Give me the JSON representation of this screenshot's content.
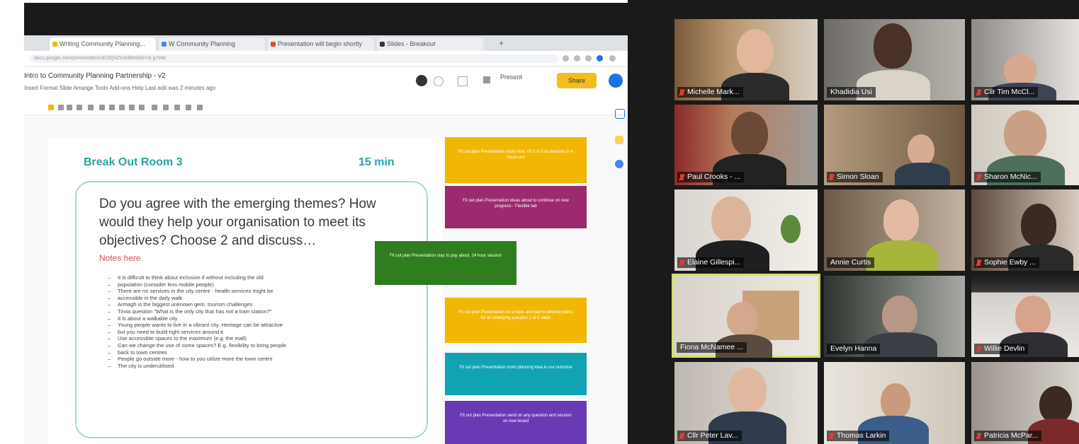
{
  "browser": {
    "tabs": [
      {
        "label": "Writing Community Planning...",
        "color": "#f4b400"
      },
      {
        "label": "W Community Planning",
        "color": "#4285f4"
      },
      {
        "label": "Presentation will begin shortly",
        "color": "#ea4335"
      },
      {
        "label": "Slides - Breakout",
        "color": "#333333"
      }
    ],
    "url": "docs.google.com/presentation/d/1fQ4Zh/edit#slide=id.g7e8c",
    "doc_title": "Intro to Community Planning Partnership - v2",
    "menu": "Insert  Format  Slide  Arrange  Tools  Add-ons  Help  Last edit was 2 minutes ago",
    "present_label": "Present",
    "share_label": "Share"
  },
  "slide": {
    "title": "Break Out Room 3",
    "time": "15 min",
    "question": "Do you agree with the emerging themes? How would they help your organisation to meet its objectives? Choose 2 and discuss…",
    "notes_label": "Notes here",
    "notes": [
      "It is difficult to think about inclusion if without including the old",
      "population (consider less mobile people)",
      "There are no services in the city centre - health services might be",
      "accessible in the daily walk",
      "Armagh is the biggest unknown gem: tourism challenges",
      "Trivia question \"What is the only city that has not a train station?\"",
      "It is about a walkable city",
      "Young people wants to live in a vibrant city. Heritage can be attractive",
      "but you need to build right services around it",
      "Use accessible spaces to the maximum (e.g. the mall)",
      "Can we change the use of some spaces? E.g. flexibility to bring people",
      "back to town centres",
      "People go outside more - how to you utilize more the town centre",
      "The city is underutilised"
    ]
  },
  "stickies": [
    {
      "text": "Fit out plan Presentation room Alex, ch 3 of 5 to decision in 4 hours out",
      "color": "#f2b705"
    },
    {
      "text": "Fit out plan Presentation ideas about to continue on new progress - Flexible tab",
      "color": "#9c2a6e"
    },
    {
      "text": "Fit out plan Presentation stay to pay about, 24 hour session",
      "color": "#2e7d1f"
    },
    {
      "text": "Fit out plan Presentation on a topic and pay to develop plans for an emerging question 2 of 5 steps",
      "color": "#f2b705"
    },
    {
      "text": "Fit out plan Presentation room planning idea in our outcome",
      "color": "#12a3b3"
    },
    {
      "text": "Fit out plan Presentation send on any question and session on new board",
      "color": "#6a3ab5"
    }
  ],
  "zoom": {
    "participants": [
      {
        "name": "Michelle Mark...",
        "muted": true
      },
      {
        "name": "Khadidia Usi",
        "muted": false
      },
      {
        "name": "Cllr Tim McCl...",
        "muted": true
      },
      {
        "name": "Paul Crooks - ...",
        "muted": true
      },
      {
        "name": "Simon Sloan",
        "muted": true
      },
      {
        "name": "Sharon McNic...",
        "muted": true
      },
      {
        "name": "Elaine Gillespi...",
        "muted": true
      },
      {
        "name": "Annie Curtis",
        "muted": false
      },
      {
        "name": "Sophie Ewby ...",
        "muted": true
      },
      {
        "name": "Fiona McNamee ...",
        "muted": false
      },
      {
        "name": "Evelyn Hanna",
        "muted": false
      },
      {
        "name": "Willie Devlin",
        "muted": true
      },
      {
        "name": "Cllr Peter Lav...",
        "muted": true
      },
      {
        "name": "Thomas Larkin",
        "muted": true
      },
      {
        "name": "Patricia McPar...",
        "muted": true
      }
    ],
    "active_speaker_index": 9
  }
}
